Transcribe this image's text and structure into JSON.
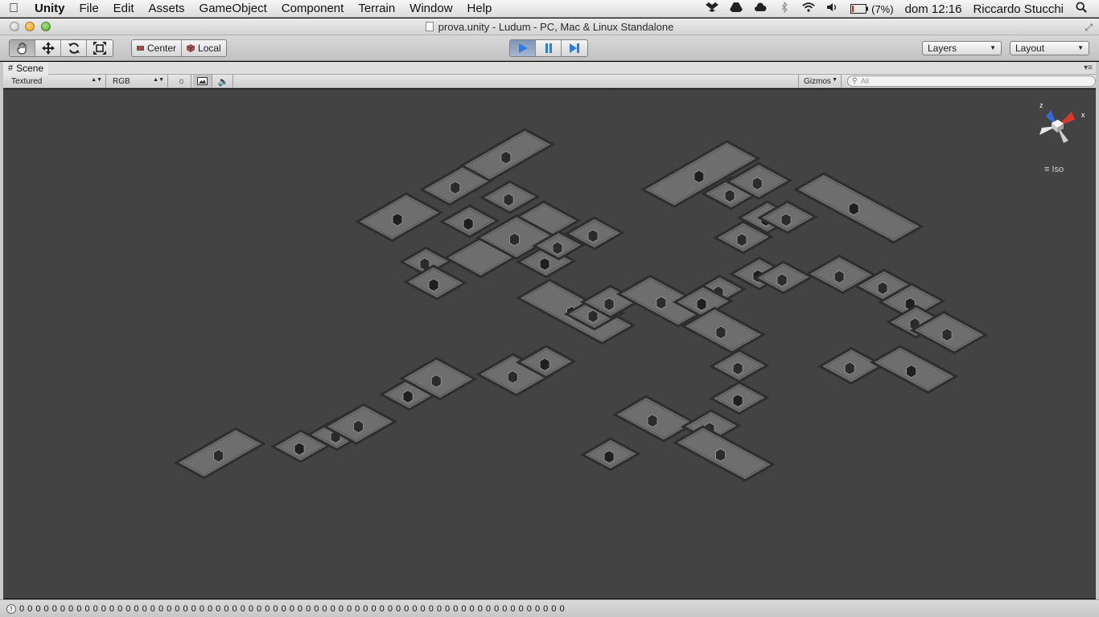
{
  "menubar": {
    "app_name": "Unity",
    "items": [
      "File",
      "Edit",
      "Assets",
      "GameObject",
      "Component",
      "Terrain",
      "Window",
      "Help"
    ],
    "battery": "(7%)",
    "clock": "dom 12:16",
    "user": "Riccardo Stucchi"
  },
  "window": {
    "title": "prova.unity - Ludum - PC, Mac & Linux Standalone"
  },
  "toolbar": {
    "pivot_center": "Center",
    "pivot_local": "Local",
    "layers_label": "Layers",
    "layout_label": "Layout"
  },
  "scene_tab": {
    "label": "Scene",
    "draw_mode": "Textured",
    "render_mode": "RGB",
    "gizmos_label": "Gizmos",
    "search_placeholder": "All",
    "projection_label": "Iso",
    "gizmo_axes": {
      "z": "z",
      "x": "x"
    }
  },
  "status": {
    "text": "0 0 0 0 0 0 0 0 0 0 0 0 0 0 0 0 0 0 0 0 0 0 0 0 0 0 0 0 0 0 0 0 0 0 0 0 0 0 0 0 0 0 0 0 0 0 0 0 0 0 0 0 0 0 0 0 0 0 0 0 0 0 0 0 0 0 0"
  },
  "colors": {
    "viewport_bg": "#434343",
    "room_floor": "#6e6e6e",
    "room_edge": "#2e2e2e",
    "play_active": "#3a7dd8"
  }
}
